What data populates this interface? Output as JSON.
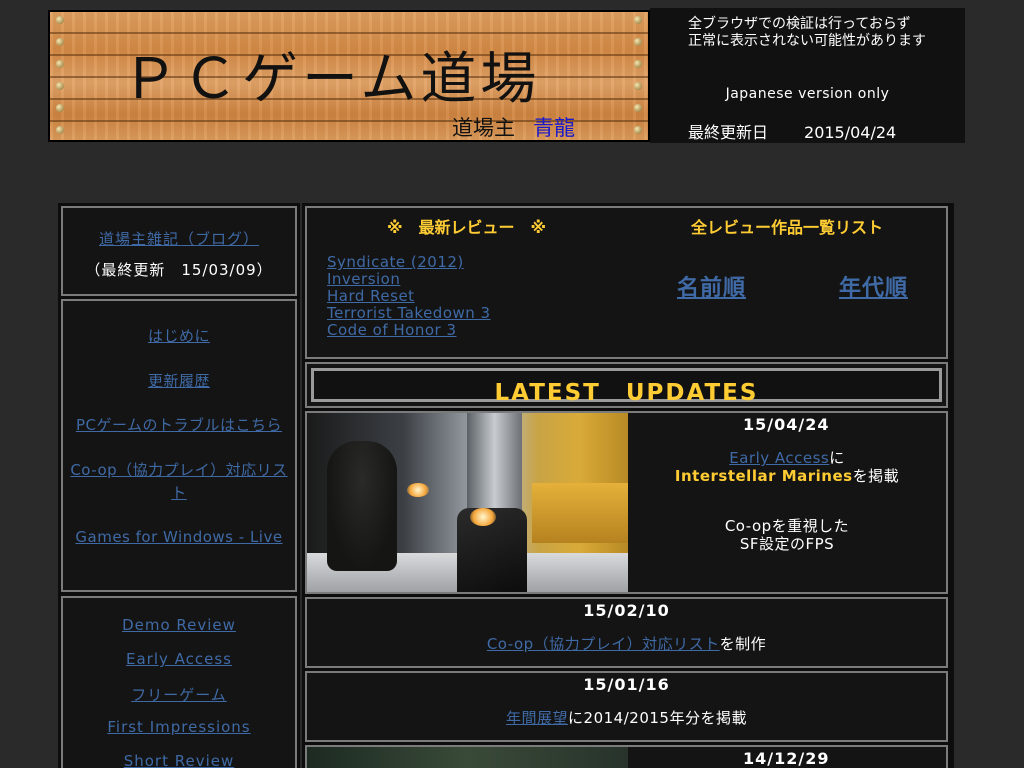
{
  "header": {
    "site_title": "ＰＣゲーム道場",
    "owner_label": "道場主",
    "owner_name": "青龍"
  },
  "notice": {
    "line1": "全ブラウザでの検証は行っておらず",
    "line2": "正常に表示されない可能性があります",
    "language_note": "Japanese version only",
    "last_updated_label": "最終更新日",
    "last_updated_date": "2015/04/24"
  },
  "blog": {
    "link": "道場主雑記（ブログ）",
    "updated": "（最終更新　15/03/09）"
  },
  "nav": [
    "はじめに",
    "更新履歴",
    "PCゲームのトラブルはこちら",
    "Co-op（協力プレイ）対応リスト",
    "Games for Windows - Live"
  ],
  "categories": [
    "Demo Review",
    "Early Access",
    "フリーゲーム",
    "First Impressions",
    "Short Review"
  ],
  "reviews": {
    "latest_heading": "※　最新レビュー　※",
    "all_heading": "全レビュー作品一覧リスト",
    "latest": [
      "Syndicate (2012)",
      "Inversion",
      "Hard Reset",
      "Terrorist Takedown 3",
      "Code of Honor 3"
    ],
    "sort_by_name": "名前順",
    "sort_by_year": "年代順"
  },
  "updates": {
    "title": "LATEST　UPDATES",
    "items": [
      {
        "date": "15/04/24",
        "link": "Early Access",
        "text1": "に",
        "highlight": "Interstellar Marines",
        "text2": "を掲載",
        "desc1": "Co-opを重視した",
        "desc2": "SF設定のFPS"
      },
      {
        "date": "15/02/10",
        "link": "Co-op（協力プレイ）対応リスト",
        "text": "を制作"
      },
      {
        "date": "15/01/16",
        "link": "年間展望",
        "text": "に2014/2015年分を掲載"
      },
      {
        "date": "14/12/29"
      }
    ]
  }
}
